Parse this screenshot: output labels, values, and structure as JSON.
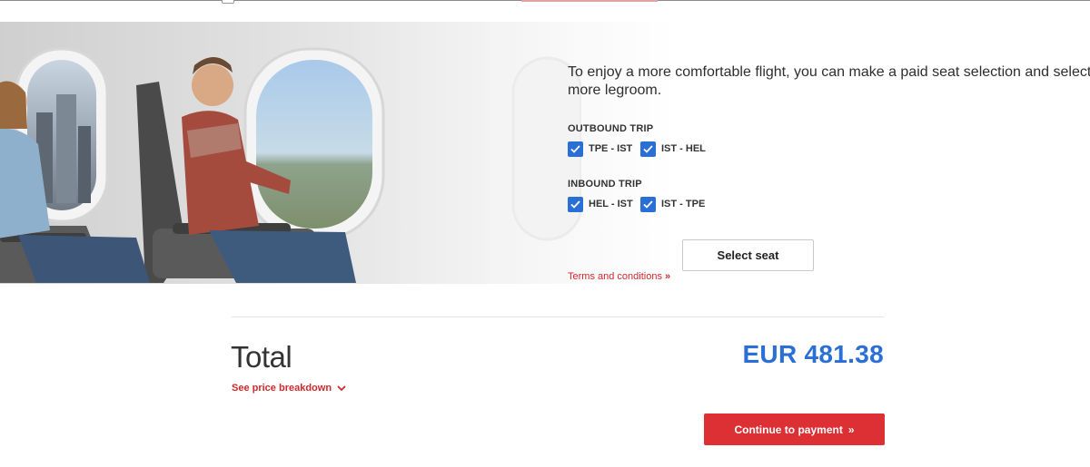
{
  "seat_section": {
    "intro_line1": "To enjoy a more comfortable flight, you can make a paid seat selection and select a s",
    "intro_line2": "more legroom.",
    "outbound": {
      "title": "OUTBOUND TRIP",
      "segments": [
        {
          "label": "TPE - IST",
          "checked": true
        },
        {
          "label": "IST - HEL",
          "checked": true
        }
      ]
    },
    "inbound": {
      "title": "INBOUND TRIP",
      "segments": [
        {
          "label": "HEL - IST",
          "checked": true
        },
        {
          "label": "IST - TPE",
          "checked": true
        }
      ]
    },
    "terms_label": "Terms and conditions",
    "terms_chevron": "»",
    "select_seat_label": "Select seat"
  },
  "summary": {
    "total_label": "Total",
    "breakdown_label": "See price breakdown",
    "price": "EUR 481.38",
    "continue_label": "Continue to payment",
    "continue_chevron": "»"
  },
  "colors": {
    "brand_red": "#dd3034",
    "accent_blue": "#2a6fd6"
  },
  "icons": {
    "checkbox": "checkmark-icon",
    "terms": "double-chevron-right-icon",
    "breakdown": "chevron-down-icon",
    "continue": "double-chevron-right-icon"
  }
}
